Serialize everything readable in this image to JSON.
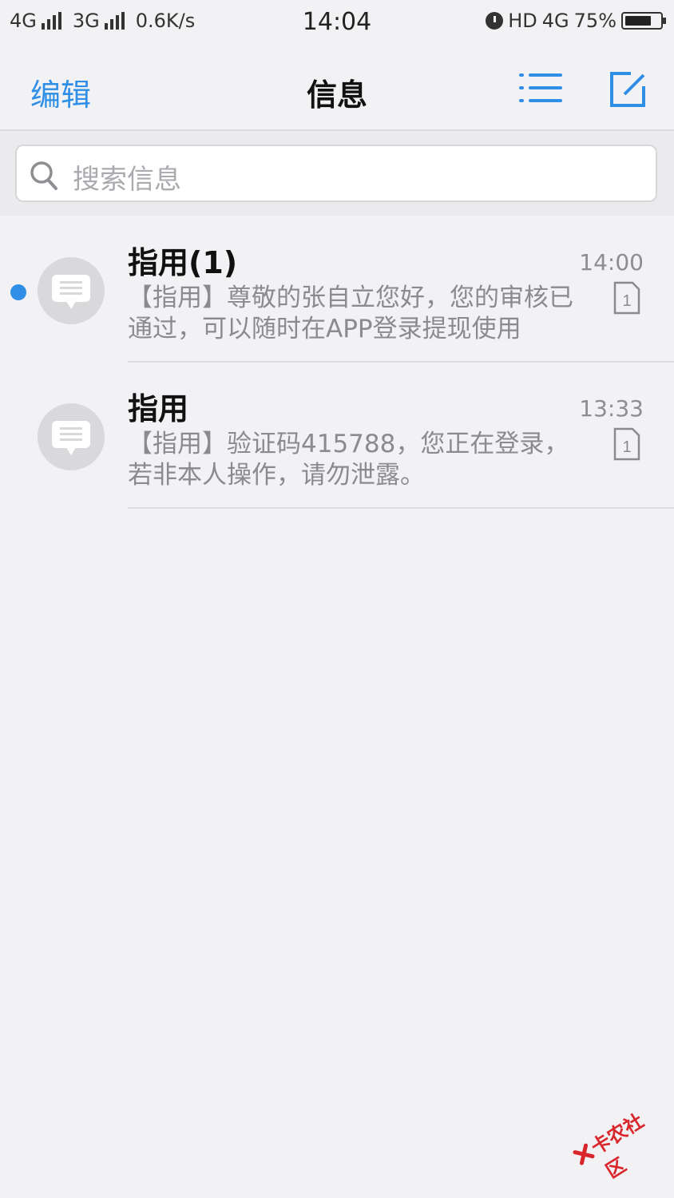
{
  "status_bar": {
    "net1": "4G",
    "net2": "3G",
    "speed": "0.6K/s",
    "time": "14:04",
    "hd": "HD",
    "net3": "4G",
    "battery": "75%",
    "battery_level": 0.75
  },
  "nav": {
    "edit_label": "编辑",
    "title": "信息",
    "accent_color": "#2f8fe6"
  },
  "search": {
    "placeholder": "搜索信息"
  },
  "conversations": [
    {
      "sender": "指用(1)",
      "time": "14:00",
      "preview_line1": "【指用】尊敬的张自立您好，您的审核已",
      "preview_line2": "通过，可以随时在APP登录提现使用",
      "sim": "1",
      "unread": true
    },
    {
      "sender": "指用",
      "time": "13:33",
      "preview_line1": "【指用】验证码415788，您正在登录，",
      "preview_line2": "若非本人操作，请勿泄露。",
      "sim": "1",
      "unread": false
    }
  ],
  "watermark": {
    "text": "卡农社区"
  }
}
